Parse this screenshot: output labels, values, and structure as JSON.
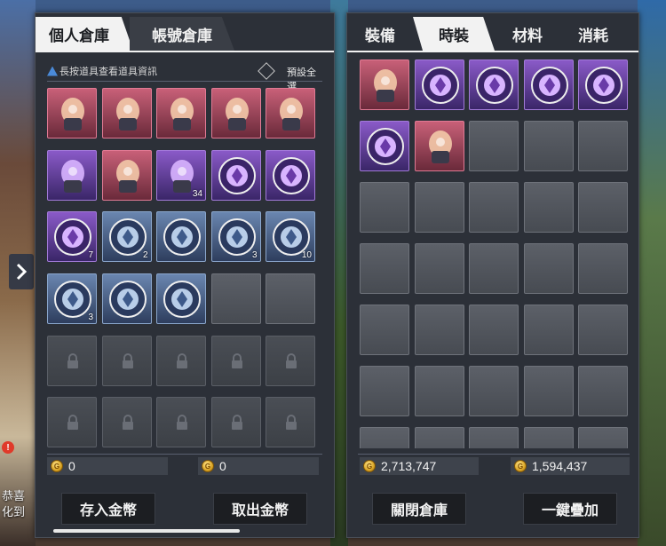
{
  "background": {
    "side_text_1": "恭喜",
    "side_text_2": "化到"
  },
  "left_panel": {
    "tabs": [
      {
        "label": "個人倉庫",
        "active": true
      },
      {
        "label": "帳號倉庫",
        "active": false
      }
    ],
    "hint": "長按道具查看道具資訊",
    "preset_label": "預設全選",
    "items": [
      {
        "rarity": "pink",
        "icon": "maid-outfit-icon",
        "qty": ""
      },
      {
        "rarity": "pink",
        "icon": "pink-hair-icon",
        "qty": ""
      },
      {
        "rarity": "pink",
        "icon": "blue-stars-icon",
        "qty": ""
      },
      {
        "rarity": "pink",
        "icon": "teapot-icon",
        "qty": ""
      },
      {
        "rarity": "pink",
        "icon": "golden-tag-icon",
        "qty": ""
      },
      {
        "rarity": "purple",
        "icon": "blue-dress-icon",
        "qty": ""
      },
      {
        "rarity": "pink",
        "icon": "red-dress-icon",
        "qty": ""
      },
      {
        "rarity": "purple",
        "icon": "backpack-icon",
        "qty": "34"
      },
      {
        "rarity": "purple",
        "icon": "purple-emblem-icon",
        "qty": ""
      },
      {
        "rarity": "purple",
        "icon": "purple-flower-emblem-icon",
        "qty": ""
      },
      {
        "rarity": "purple",
        "icon": "purple-wing-emblem-icon",
        "qty": "7"
      },
      {
        "rarity": "blue",
        "icon": "hat-emblem-icon",
        "qty": "2"
      },
      {
        "rarity": "blue",
        "icon": "cd-emblem-icon",
        "qty": ""
      },
      {
        "rarity": "blue",
        "icon": "mushroom-emblem-icon",
        "qty": "3"
      },
      {
        "rarity": "blue",
        "icon": "flower-emblem-icon",
        "qty": "10"
      },
      {
        "rarity": "blue",
        "icon": "beetle-emblem-icon",
        "qty": "3"
      },
      {
        "rarity": "blue",
        "icon": "wheel-emblem-icon",
        "qty": ""
      },
      {
        "rarity": "blue",
        "icon": "star-emblem-icon",
        "qty": ""
      },
      {
        "rarity": "empty",
        "icon": "",
        "qty": ""
      },
      {
        "rarity": "empty",
        "icon": "",
        "qty": ""
      },
      {
        "rarity": "locked",
        "icon": "lock-icon",
        "qty": ""
      },
      {
        "rarity": "locked",
        "icon": "lock-icon",
        "qty": ""
      },
      {
        "rarity": "locked",
        "icon": "lock-icon",
        "qty": ""
      },
      {
        "rarity": "locked",
        "icon": "lock-icon",
        "qty": ""
      },
      {
        "rarity": "locked",
        "icon": "lock-icon",
        "qty": ""
      },
      {
        "rarity": "locked",
        "icon": "lock-icon",
        "qty": ""
      },
      {
        "rarity": "locked",
        "icon": "lock-icon",
        "qty": ""
      },
      {
        "rarity": "locked",
        "icon": "lock-icon",
        "qty": ""
      },
      {
        "rarity": "locked",
        "icon": "lock-icon",
        "qty": ""
      },
      {
        "rarity": "locked",
        "icon": "lock-icon",
        "qty": ""
      }
    ],
    "gold_left": "0",
    "gold_right": "0",
    "deposit_button": "存入金幣",
    "withdraw_button": "取出金幣"
  },
  "right_panel": {
    "tabs": [
      {
        "label": "裝備",
        "active": false
      },
      {
        "label": "時裝",
        "active": true
      },
      {
        "label": "材料",
        "active": false
      },
      {
        "label": "消耗",
        "active": false
      }
    ],
    "items": [
      {
        "rarity": "pink",
        "icon": "mechanical-fox-icon",
        "qty": ""
      },
      {
        "rarity": "purple",
        "icon": "castle-emblem-icon",
        "qty": ""
      },
      {
        "rarity": "purple",
        "icon": "fish-emblem-icon",
        "qty": ""
      },
      {
        "rarity": "purple",
        "icon": "balloon-emblem-icon",
        "qty": ""
      },
      {
        "rarity": "purple",
        "icon": "windmill-emblem-icon",
        "qty": ""
      },
      {
        "rarity": "purple",
        "icon": "flag-emblem-icon",
        "qty": ""
      },
      {
        "rarity": "pink",
        "icon": "blonde-hair-icon",
        "qty": ""
      },
      {
        "rarity": "empty",
        "icon": "",
        "qty": ""
      },
      {
        "rarity": "empty",
        "icon": "",
        "qty": ""
      },
      {
        "rarity": "empty",
        "icon": "",
        "qty": ""
      },
      {
        "rarity": "empty",
        "icon": "",
        "qty": ""
      },
      {
        "rarity": "empty",
        "icon": "",
        "qty": ""
      },
      {
        "rarity": "empty",
        "icon": "",
        "qty": ""
      },
      {
        "rarity": "empty",
        "icon": "",
        "qty": ""
      },
      {
        "rarity": "empty",
        "icon": "",
        "qty": ""
      },
      {
        "rarity": "empty",
        "icon": "",
        "qty": ""
      },
      {
        "rarity": "empty",
        "icon": "",
        "qty": ""
      },
      {
        "rarity": "empty",
        "icon": "",
        "qty": ""
      },
      {
        "rarity": "empty",
        "icon": "",
        "qty": ""
      },
      {
        "rarity": "empty",
        "icon": "",
        "qty": ""
      },
      {
        "rarity": "empty",
        "icon": "",
        "qty": ""
      },
      {
        "rarity": "empty",
        "icon": "",
        "qty": ""
      },
      {
        "rarity": "empty",
        "icon": "",
        "qty": ""
      },
      {
        "rarity": "empty",
        "icon": "",
        "qty": ""
      },
      {
        "rarity": "empty",
        "icon": "",
        "qty": ""
      },
      {
        "rarity": "empty",
        "icon": "",
        "qty": ""
      },
      {
        "rarity": "empty",
        "icon": "",
        "qty": ""
      },
      {
        "rarity": "empty",
        "icon": "",
        "qty": ""
      },
      {
        "rarity": "empty",
        "icon": "",
        "qty": ""
      },
      {
        "rarity": "empty",
        "icon": "",
        "qty": ""
      },
      {
        "rarity": "empty",
        "icon": "",
        "qty": ""
      },
      {
        "rarity": "empty",
        "icon": "",
        "qty": ""
      },
      {
        "rarity": "empty",
        "icon": "",
        "qty": ""
      },
      {
        "rarity": "empty",
        "icon": "",
        "qty": ""
      },
      {
        "rarity": "empty",
        "icon": "",
        "qty": ""
      }
    ],
    "gold_left": "2,713,747",
    "gold_right": "1,594,437",
    "close_button": "關閉倉庫",
    "stack_button": "一鍵疊加"
  },
  "colors": {
    "panel_bg": "#2c3038",
    "tab_active": "#f2f2f2",
    "pink": "#c86078",
    "purple": "#8a5ac8",
    "blue": "#6a86b0"
  }
}
